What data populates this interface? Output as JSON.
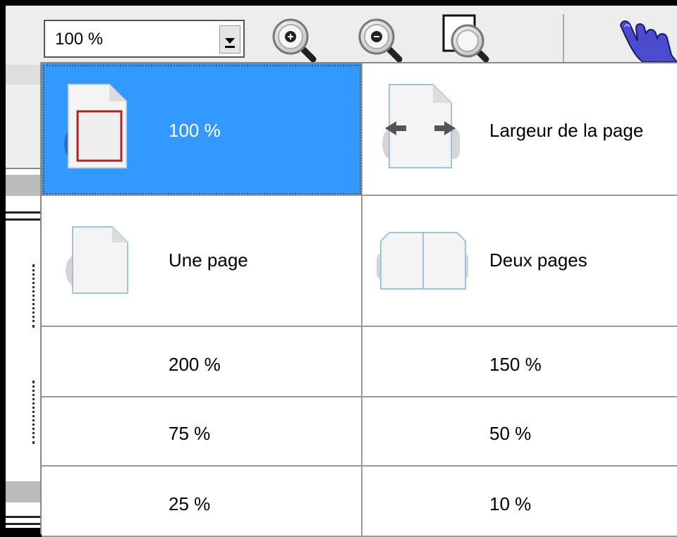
{
  "toolbar": {
    "zoom_value": "100 %",
    "icons": [
      "zoom-in-icon",
      "zoom-out-icon",
      "zoom-fit-icon",
      "hand-tool-icon"
    ]
  },
  "zoom_menu": {
    "items": [
      {
        "label": "100 %",
        "icon": "page-actual-size-icon",
        "selected": true
      },
      {
        "label": "Largeur de la page",
        "icon": "page-width-icon",
        "selected": false
      },
      {
        "label": "Une page",
        "icon": "one-page-icon",
        "selected": false
      },
      {
        "label": "Deux pages",
        "icon": "two-pages-icon",
        "selected": false
      },
      {
        "label": "200 %",
        "selected": false
      },
      {
        "label": "150 %",
        "selected": false
      },
      {
        "label": "75 %",
        "selected": false
      },
      {
        "label": "50 %",
        "selected": false
      },
      {
        "label": "25 %",
        "selected": false
      },
      {
        "label": "10 %",
        "selected": false
      }
    ]
  },
  "colors": {
    "selection": "#3399ff",
    "grid_line": "#9a9a9a",
    "toolbar_bg": "#ededed",
    "hand_icon": "#4b4bd0"
  }
}
